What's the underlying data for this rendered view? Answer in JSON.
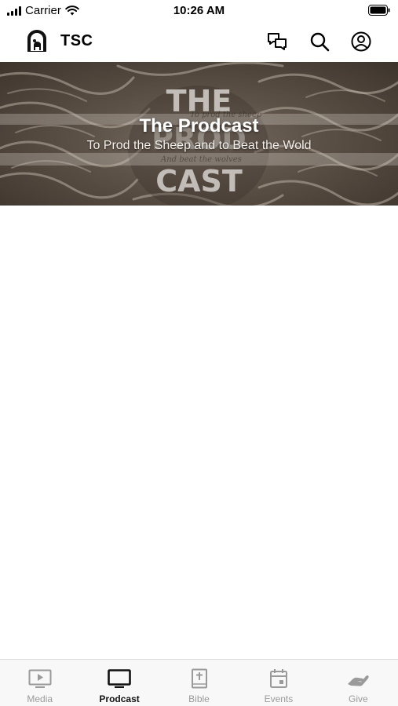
{
  "status_bar": {
    "carrier": "Carrier",
    "time": "10:26 AM"
  },
  "header": {
    "title": "TSC",
    "icons": [
      "chat-icon",
      "search-icon",
      "profile-icon"
    ]
  },
  "hero": {
    "title": "The Prodcast",
    "subtitle": "To Prod the Sheep and to Beat the Wold",
    "artwork_text": {
      "line1": "THE",
      "line2": "PROD",
      "line3": "CAST",
      "script1": "To prod the sheep",
      "script2": "And beat the wolves"
    }
  },
  "tabs": [
    {
      "label": "Media",
      "icon": "play-icon",
      "active": false
    },
    {
      "label": "Prodcast",
      "icon": "tv-icon",
      "active": true
    },
    {
      "label": "Bible",
      "icon": "bible-icon",
      "active": false
    },
    {
      "label": "Events",
      "icon": "calendar-icon",
      "active": false
    },
    {
      "label": "Give",
      "icon": "hand-icon",
      "active": false
    }
  ],
  "colors": {
    "active_tab": "#111111",
    "inactive_tab": "#9a9a9a",
    "tab_bar_bg": "#f8f8f8"
  }
}
